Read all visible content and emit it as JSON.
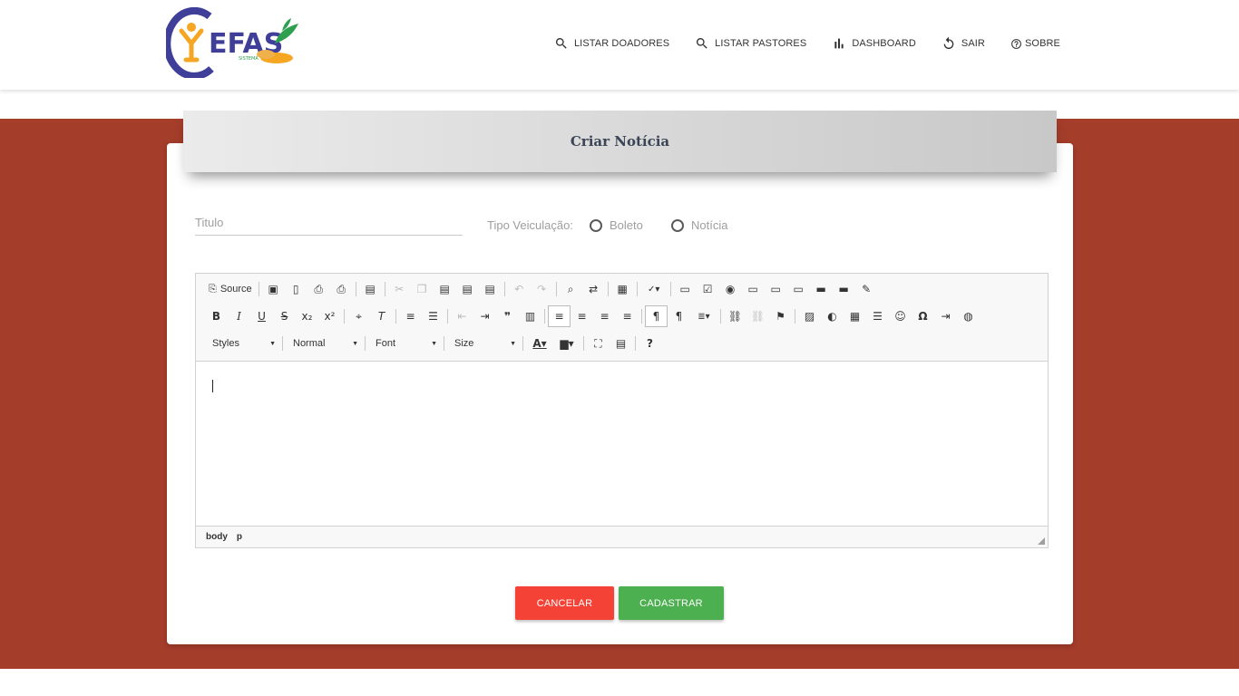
{
  "brand": {
    "name": "EFAS",
    "sub": "SISTEMA"
  },
  "nav": [
    {
      "label": "LISTAR DOADORES",
      "icon": "search-icon"
    },
    {
      "label": "LISTAR PASTORES",
      "icon": "search-icon"
    },
    {
      "label": "DASHBOARD",
      "icon": "bar-chart-icon"
    },
    {
      "label": "SAIR",
      "icon": "refresh-icon"
    },
    {
      "label": "SOBRE",
      "icon": "help-icon"
    }
  ],
  "form": {
    "title": "Criar Notícia",
    "titulo_placeholder": "Titulo",
    "tipo_label": "Tipo Veiculação:",
    "options": [
      "Boleto",
      "Notícia"
    ]
  },
  "editor": {
    "source_label": "Source",
    "combos": [
      "Styles",
      "Normal",
      "Font",
      "Size"
    ],
    "path": [
      "body",
      "p"
    ]
  },
  "buttons": {
    "cancel": "CANCELAR",
    "save": "CADASTRAR"
  },
  "colors": {
    "band": "#a53d2b",
    "cancel": "#f44336",
    "save": "#4caf50",
    "brand_blue": "#3f3f9a",
    "brand_orange": "#f5a623"
  }
}
